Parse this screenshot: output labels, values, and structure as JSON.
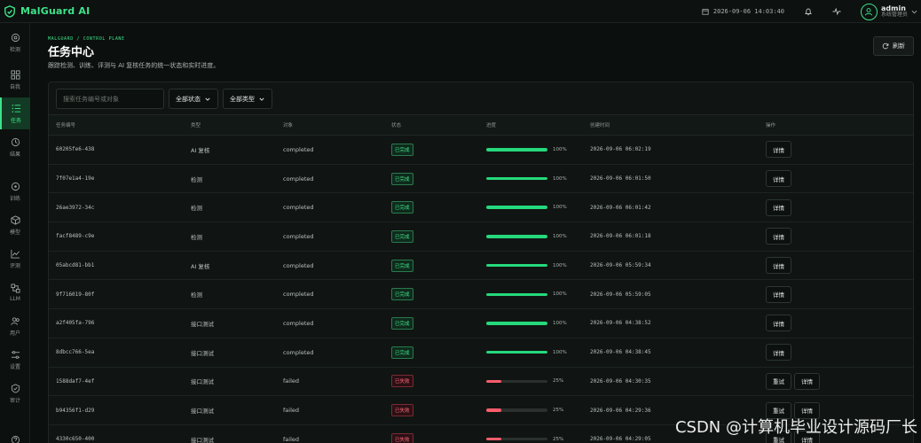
{
  "app": {
    "name": "MalGuard AI"
  },
  "topbar": {
    "datetime": "2026-09-06 14:03:40",
    "user_name": "admin",
    "user_role": "系统管理员"
  },
  "sidebar": {
    "items": [
      {
        "label": "检测",
        "icon": "target-icon",
        "active": false
      },
      {
        "label": "自我",
        "icon": "grid-icon",
        "active": false
      },
      {
        "label": "任务",
        "icon": "list-icon",
        "active": true
      },
      {
        "label": "结果",
        "icon": "history-icon",
        "active": false
      },
      {
        "label": "训练",
        "icon": "cluster-icon",
        "active": false
      },
      {
        "label": "模型",
        "icon": "cube-icon",
        "active": false
      },
      {
        "label": "评测",
        "icon": "chart-icon",
        "active": false
      },
      {
        "label": "LLM",
        "icon": "nodes-icon",
        "active": false
      },
      {
        "label": "用户",
        "icon": "users-icon",
        "active": false
      },
      {
        "label": "设置",
        "icon": "sliders-icon",
        "active": false
      },
      {
        "label": "审计",
        "icon": "shield-icon",
        "active": false
      }
    ]
  },
  "header": {
    "breadcrumb": "MALGUARD / CONTROL PLANE",
    "title": "任务中心",
    "description": "跟踪检测、训练、评测与 AI 复核任务的统一状态和实时进度。",
    "refresh_label": "刷新"
  },
  "filters": {
    "search_placeholder": "搜索任务编号或对象",
    "status_label": "全部状态",
    "type_label": "全部类型"
  },
  "table": {
    "columns": [
      "任务编号",
      "类型",
      "对象",
      "状态",
      "进度",
      "创建时间",
      "操作"
    ],
    "rows": [
      {
        "id": "60205fe6-438",
        "type": "AI 复核",
        "target": "completed",
        "status": "已完成",
        "status_kind": "ok",
        "progress": 100,
        "progress_text": "100%",
        "created": "2026-09-06 06:02:19",
        "actions": [
          "详情"
        ]
      },
      {
        "id": "7f07e1a4-19e",
        "type": "检测",
        "target": "completed",
        "status": "已完成",
        "status_kind": "ok",
        "progress": 100,
        "progress_text": "100%",
        "created": "2026-09-06 06:01:50",
        "actions": [
          "详情"
        ]
      },
      {
        "id": "26ae3972-34c",
        "type": "检测",
        "target": "completed",
        "status": "已完成",
        "status_kind": "ok",
        "progress": 100,
        "progress_text": "100%",
        "created": "2026-09-06 06:01:42",
        "actions": [
          "详情"
        ]
      },
      {
        "id": "facf8489-c9e",
        "type": "检测",
        "target": "completed",
        "status": "已完成",
        "status_kind": "ok",
        "progress": 100,
        "progress_text": "100%",
        "created": "2026-09-06 06:01:18",
        "actions": [
          "详情"
        ]
      },
      {
        "id": "05abcd81-bb1",
        "type": "AI 复核",
        "target": "completed",
        "status": "已完成",
        "status_kind": "ok",
        "progress": 100,
        "progress_text": "100%",
        "created": "2026-09-06 05:59:34",
        "actions": [
          "详情"
        ]
      },
      {
        "id": "9f716019-80f",
        "type": "检测",
        "target": "completed",
        "status": "已完成",
        "status_kind": "ok",
        "progress": 100,
        "progress_text": "100%",
        "created": "2026-09-06 05:59:05",
        "actions": [
          "详情"
        ]
      },
      {
        "id": "a2f405fa-796",
        "type": "接口测试",
        "target": "completed",
        "status": "已完成",
        "status_kind": "ok",
        "progress": 100,
        "progress_text": "100%",
        "created": "2026-09-06 04:38:52",
        "actions": [
          "详情"
        ]
      },
      {
        "id": "8dbcc766-5ea",
        "type": "接口测试",
        "target": "completed",
        "status": "已完成",
        "status_kind": "ok",
        "progress": 100,
        "progress_text": "100%",
        "created": "2026-09-06 04:38:45",
        "actions": [
          "详情"
        ]
      },
      {
        "id": "1588daf7-4ef",
        "type": "接口测试",
        "target": "failed",
        "status": "已失败",
        "status_kind": "fail",
        "progress": 25,
        "progress_text": "25%",
        "created": "2026-09-06 04:30:35",
        "actions": [
          "重试",
          "详情"
        ]
      },
      {
        "id": "b94356f1-d29",
        "type": "接口测试",
        "target": "failed",
        "status": "已失败",
        "status_kind": "fail",
        "progress": 25,
        "progress_text": "25%",
        "created": "2026-09-06 04:29:36",
        "actions": [
          "重试",
          "详情"
        ]
      },
      {
        "id": "4330c650-400",
        "type": "接口测试",
        "target": "failed",
        "status": "已失败",
        "status_kind": "fail",
        "progress": 25,
        "progress_text": "25%",
        "created": "2026-09-06 04:29:05",
        "actions": [
          "重试",
          "详情"
        ]
      }
    ]
  },
  "watermark": "CSDN @计算机毕业设计源码厂长",
  "colors": {
    "accent": "#3ee38a",
    "success": "#25d97c",
    "danger": "#ff5c6c",
    "background": "#0b0f0d"
  }
}
